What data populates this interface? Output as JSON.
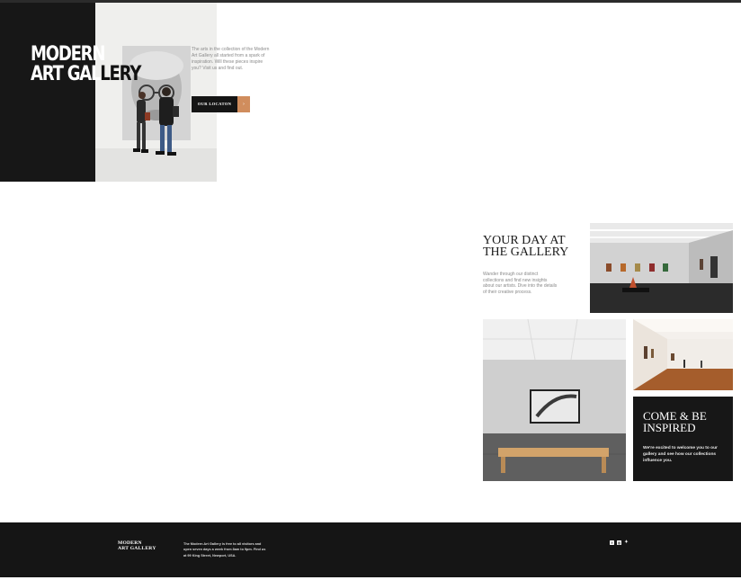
{
  "hero": {
    "title_line1": "MODERN",
    "title_line2_a": "ART GAL",
    "title_line2_b": "LERY",
    "text": "The arts in the collection of the Modern Art Gallery all started from a spark of inspiration. Will these pieces inspire you? Visit us and find out.",
    "button_label": "OUR LOCATON",
    "button_arrow": "›"
  },
  "feature": {
    "title": "YOUR DAY AT THE GALLERY",
    "text": "Wander through our distinct collections and find new insights about our artists. Dive into the details of their creative process.",
    "card_title": "COME & BE INSPIRED",
    "card_text": "We're excited to welcome you to our gallery and see how our collections influence you."
  },
  "footer": {
    "logo_line1": "MODERN",
    "logo_line2": "ART GALLERY",
    "text": "The Modern Art Gallery is free to all visitors and open seven days a week from 8am to 9pm. Find us at 99 King Street, Newport, USA.",
    "socials": [
      "facebook-icon",
      "instagram-icon",
      "twitter-icon"
    ]
  },
  "colors": {
    "dark": "#171717",
    "accent": "#d08d5d",
    "muted_text": "#8a8a8a"
  }
}
